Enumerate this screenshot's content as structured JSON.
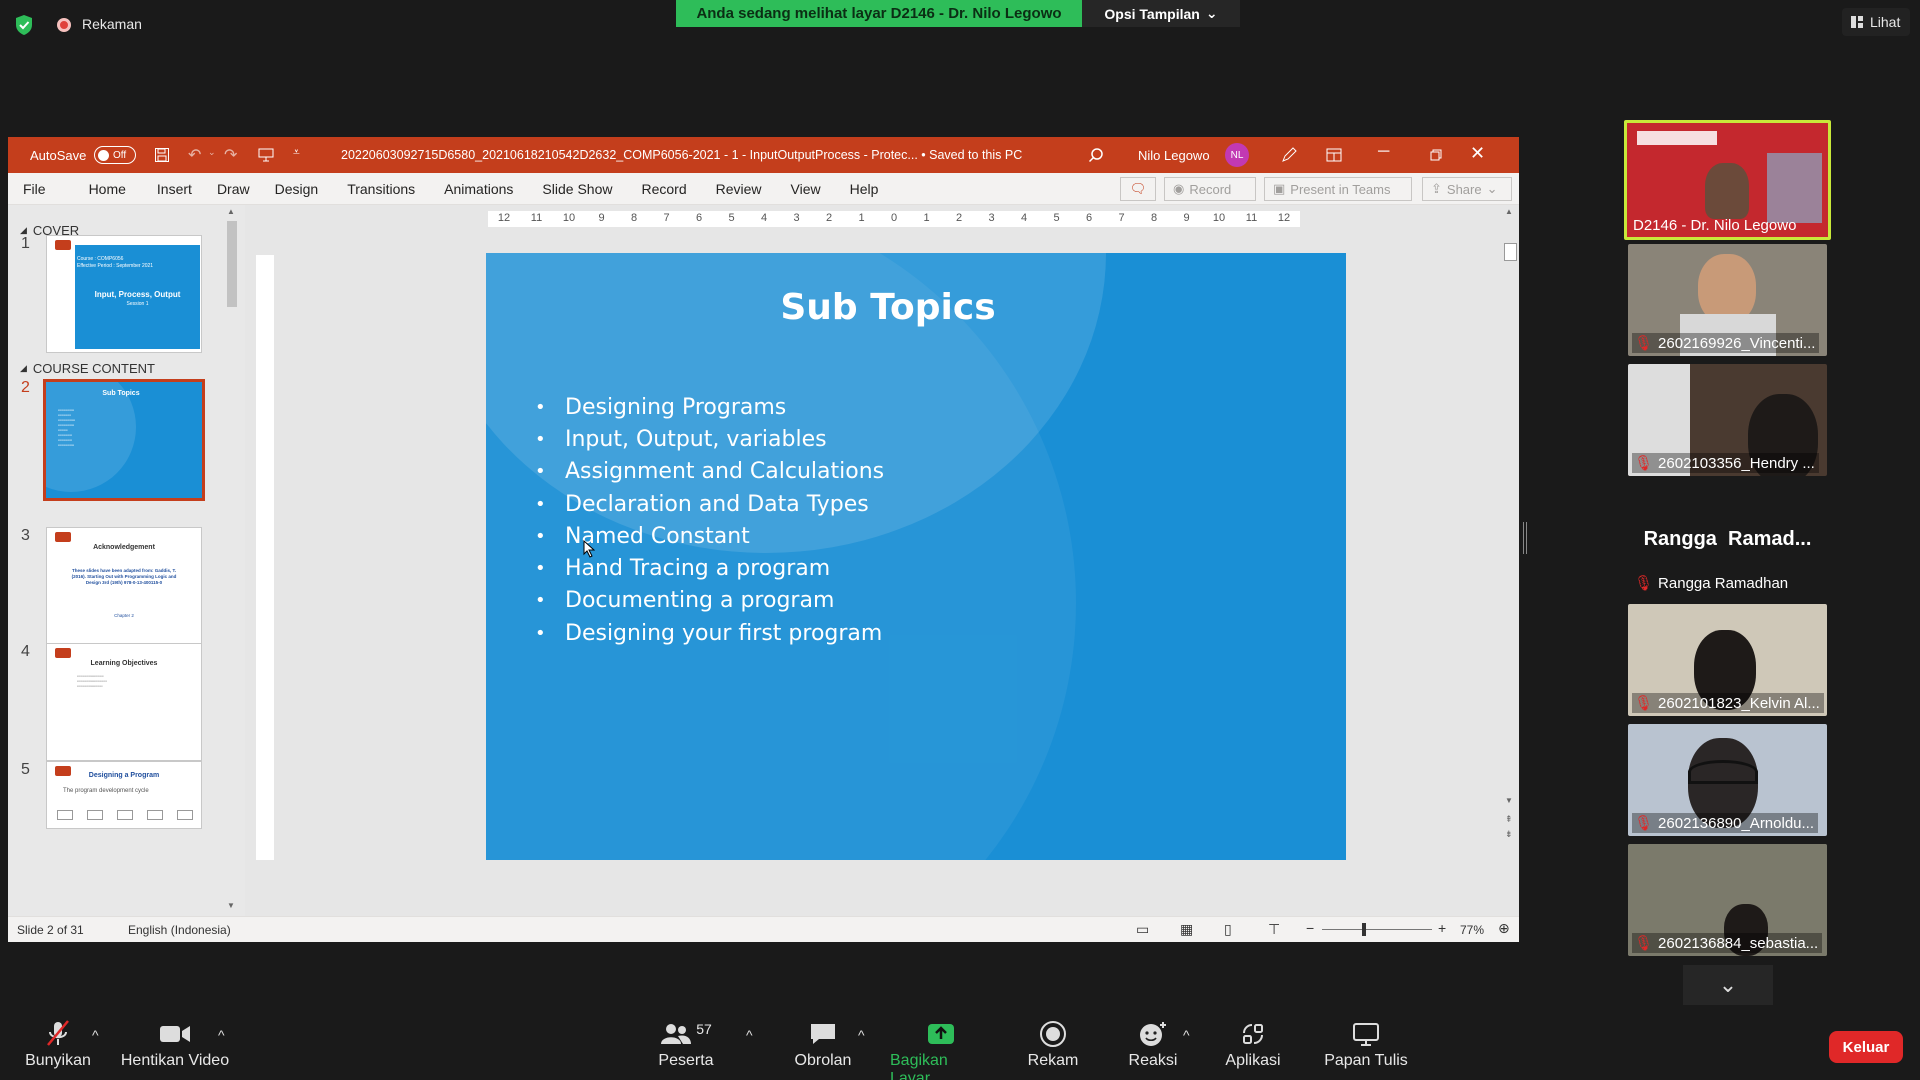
{
  "zoom": {
    "recording_label": "Rekaman",
    "share_banner": "Anda sedang melihat layar D2146 - Dr. Nilo Legowo",
    "view_options": "Opsi Tampilan",
    "view_button": "Lihat",
    "exit_button": "Keluar",
    "toolbar": {
      "mute": "Bunyikan",
      "video": "Hentikan Video",
      "participants": "Peserta",
      "participants_count": "57",
      "chat": "Obrolan",
      "share": "Bagikan Layar",
      "record": "Rekam",
      "reactions": "Reaksi",
      "apps": "Aplikasi",
      "whiteboard": "Papan Tulis"
    },
    "participants": [
      {
        "name": "D2146 - Dr. Nilo Legowo",
        "active": true,
        "muted": false
      },
      {
        "name": "2602169926_Vincenti...",
        "muted": true
      },
      {
        "name": "2602103356_Hendry ...",
        "muted": true
      },
      {
        "name": "Rangga Ramadhan",
        "display": "Rangga  Ramad...",
        "muted": true
      },
      {
        "name": "2602101823_Kelvin Al...",
        "muted": true
      },
      {
        "name": "2602136890_Arnoldu...",
        "muted": true
      },
      {
        "name": "2602136884_sebastia...",
        "muted": true
      }
    ]
  },
  "ppt": {
    "autosave_label": "AutoSave",
    "autosave_state": "Off",
    "filename": "20220603092715D6580_20210618210542D2632_COMP6056-2021 - 1 - InputOutputProcess  -  Protec... • Saved to this PC",
    "user_name": "Nilo Legowo",
    "user_initials": "NL",
    "tabs": [
      "File",
      "Home",
      "Insert",
      "Draw",
      "Design",
      "Transitions",
      "Animations",
      "Slide Show",
      "Record",
      "Review",
      "View",
      "Help"
    ],
    "buttons": {
      "record": "Record",
      "present": "Present in Teams",
      "share": "Share"
    },
    "sections": {
      "cover": "COVER",
      "content": "COURSE CONTENT"
    },
    "thumbs": {
      "t1": {
        "course": "Course",
        "course_val": ": COMP6056",
        "period": "Effective Period",
        "period_val": ": September 2021",
        "title": "Input, Process, Output",
        "session": "Session 1"
      },
      "t2": {
        "title": "Sub Topics"
      },
      "t3": {
        "title": "Acknowledgement",
        "body": "These slides have been adapted from: Gaddis, T. (2016). Starting Out with Programming Logic and Design 3rd (19th) 978-0-13-400115-0",
        "chapter": "Chapter 2"
      },
      "t4": {
        "title": "Learning Objectives"
      },
      "t5": {
        "title": "Designing a Program",
        "sub": "The program development cycle"
      }
    },
    "slide": {
      "title": "Sub Topics",
      "bullets": [
        "Designing Programs",
        "Input, Output, variables",
        "Assignment and Calculations",
        "Declaration and Data Types",
        "Named Constant",
        "Hand Tracing a program",
        "Documenting a program",
        "Designing your first program"
      ]
    },
    "ruler_ticks": [
      "12",
      "11",
      "10",
      "9",
      "8",
      "7",
      "6",
      "5",
      "4",
      "3",
      "2",
      "1",
      "0",
      "1",
      "2",
      "3",
      "4",
      "5",
      "6",
      "7",
      "8",
      "9",
      "10",
      "11",
      "12"
    ],
    "status": {
      "slide": "Slide 2 of 31",
      "language": "English (Indonesia)",
      "zoom": "77%"
    },
    "colors": {
      "accent": "#c43e1c",
      "slide_bg": "#1a8fd5"
    }
  }
}
